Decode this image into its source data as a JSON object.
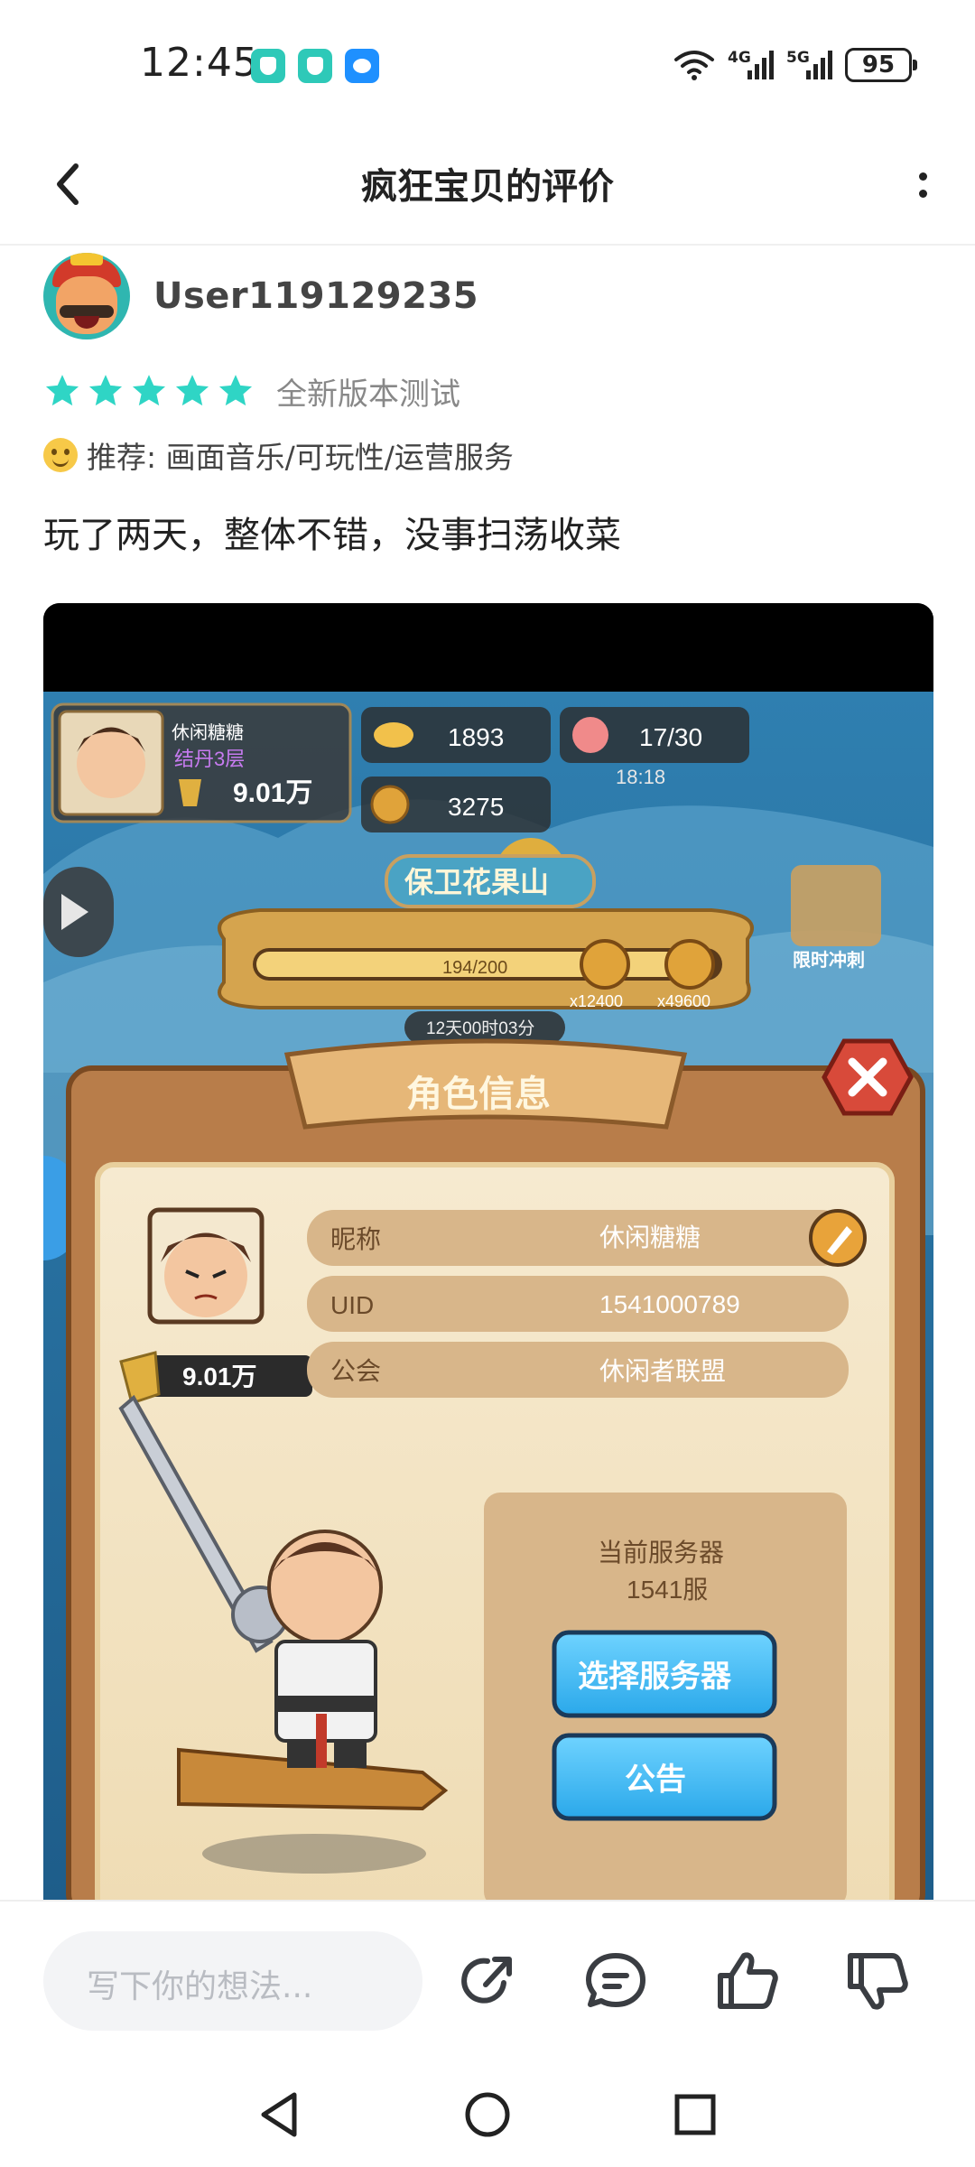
{
  "status_bar": {
    "time": "12:45",
    "signal_1": "4G",
    "signal_2": "5G",
    "battery": "95"
  },
  "header": {
    "title": "疯狂宝贝的评价"
  },
  "reviewer": {
    "username": "User119129235"
  },
  "rating": {
    "stars": 5,
    "tag": "全新版本测试"
  },
  "recommend": {
    "text": "推荐: 画面音乐/可玩性/运营服务"
  },
  "review": {
    "text": "玩了两天，整体不错，没事扫荡收菜"
  },
  "game": {
    "player_name": "休闲糖糖",
    "player_rank": "结丹3层",
    "power": "9.01万",
    "gold": "1893",
    "stamina": "17/30",
    "stamina_timer": "18:18",
    "coins": "3275",
    "event_title": "保卫花果山",
    "event_progress_text": "194/200",
    "event_progress": 0.97,
    "reward_1": "x12400",
    "reward_2": "x49600",
    "countdown": "12天00时03分",
    "limited_label": "限时冲刺",
    "dialog_title": "角色信息",
    "fields": [
      {
        "label": "昵称",
        "value": "休闲糖糖"
      },
      {
        "label": "UID",
        "value": "1541000789"
      },
      {
        "label": "公会",
        "value": "休闲者联盟"
      }
    ],
    "server_label": "当前服务器",
    "server_value": "1541服",
    "select_server_button": "选择服务器",
    "notice_button": "公告"
  },
  "bottom_bar": {
    "comment_placeholder": "写下你的想法..."
  }
}
